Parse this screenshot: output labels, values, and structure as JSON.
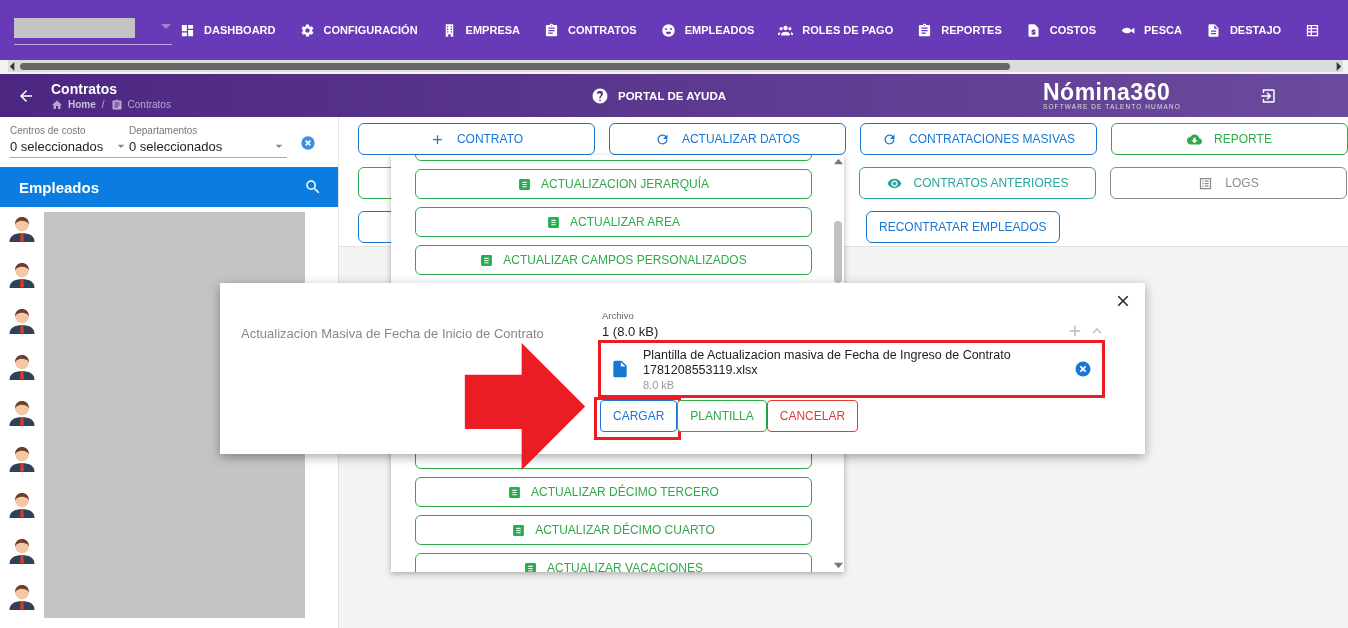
{
  "top_nav": {
    "items": [
      {
        "label": "DASHBOARD"
      },
      {
        "label": "CONFIGURACIÓN"
      },
      {
        "label": "EMPRESA"
      },
      {
        "label": "CONTRATOS"
      },
      {
        "label": "EMPLEADOS"
      },
      {
        "label": "ROLES DE PAGO"
      },
      {
        "label": "REPORTES"
      },
      {
        "label": "COSTOS"
      },
      {
        "label": "PESCA"
      },
      {
        "label": "DESTAJO"
      }
    ]
  },
  "header": {
    "title": "Contratos",
    "breadcrumb": [
      "Home",
      "Contratos"
    ],
    "breadcrumb_separator": "/",
    "help_link": "PORTAL DE AYUDA",
    "logo": {
      "name": "Nómina360",
      "tagline": "SOFTWARE DE TALENTO HUMANO"
    }
  },
  "filters": [
    {
      "label": "Centros de costo",
      "value": "0 seleccionados"
    },
    {
      "label": "Departamentos",
      "value": "0 seleccionados"
    }
  ],
  "employees": {
    "title": "Empleados"
  },
  "action_rows": [
    [
      {
        "kind": "full",
        "label": "CONTRATO",
        "color": "#1976d2"
      },
      {
        "kind": "full",
        "label": "ACTUALIZAR DATOS",
        "color": "#1976d2"
      },
      {
        "kind": "full",
        "label": "CONTRATACIONES MASIVAS",
        "color": "#1976d2"
      },
      {
        "kind": "full",
        "label": "REPORTE",
        "color": "#2eaa4a"
      }
    ],
    [
      {
        "kind": "covered",
        "color": "#2eaa4a"
      },
      {
        "kind": "full",
        "label": "CONTRATOS ANTERIORES",
        "color": "#26a69a"
      },
      {
        "kind": "full",
        "label": "LOGS",
        "color": "#8a8a8a"
      }
    ],
    [
      {
        "kind": "covered",
        "color": "#1976d2"
      },
      {
        "kind": "compact",
        "label": "RECONTRATAR EMPLEADOS",
        "color": "#1976d2"
      }
    ]
  ],
  "menu": {
    "upper_items": [
      {
        "kind": "partial"
      },
      {
        "kind": "full",
        "label": "ACTUALIZACION JERARQUÍA"
      },
      {
        "kind": "full",
        "label": "ACTUALIZAR AREA"
      },
      {
        "kind": "full",
        "label": "ACTUALIZAR CAMPOS PERSONALIZADOS"
      }
    ],
    "lower_items": [
      {
        "kind": "partial"
      },
      {
        "kind": "full",
        "label": "ACTUALIZAR DÉCIMO TERCERO"
      },
      {
        "kind": "full",
        "label": "ACTUALIZAR DÉCIMO CUARTO"
      },
      {
        "kind": "full",
        "label": "ACTUALIZAR VACACIONES"
      }
    ]
  },
  "modal": {
    "title": "Actualizacion Masiva de Fecha de Inicio de Contrato",
    "file_input": {
      "label": "Archivo",
      "summary": "1 (8.0 kB)",
      "files": [
        {
          "name": "Plantilla de Actualizacion masiva de Fecha de Ingreso de Contrato 1781208553119.xlsx",
          "size": "8.0 kB",
          "highlighted": true
        }
      ]
    },
    "buttons": [
      {
        "label": "CARGAR",
        "color": "#1976d2",
        "highlighted": true
      },
      {
        "label": "PLANTILLA",
        "color": "#2eaa4a",
        "highlighted": false
      },
      {
        "label": "CANCELAR",
        "color": "#e53935",
        "highlighted": false
      }
    ]
  }
}
